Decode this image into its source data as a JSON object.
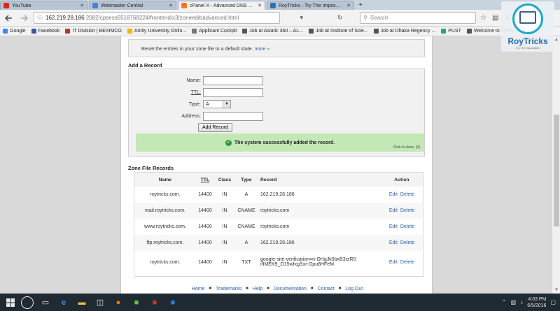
{
  "browser": {
    "tabs": [
      {
        "label": "YouTube",
        "color": "#e62117",
        "active": false
      },
      {
        "label": "Webmaster Central",
        "color": "#4a7fd6",
        "active": false
      },
      {
        "label": "cPanel X - Advanced DNS ...",
        "color": "#f47a20",
        "active": true
      },
      {
        "label": "RoyTricks - Try The Impos...",
        "color": "#2f71b5",
        "active": false
      }
    ],
    "tab_close": "✕",
    "new_tab": "+",
    "url_host": "162.219.28.186",
    "url_path": ":2082/cpsess6518768224/frontend/x3/zoneedit/advanced.html",
    "search_placeholder": "Search",
    "bookmarks": [
      {
        "label": "Google",
        "color": "#4285f4"
      },
      {
        "label": "Facebook",
        "color": "#3b5998"
      },
      {
        "label": "IT Division | BEXIMCO",
        "color": "#b33"
      },
      {
        "label": "Amity University Onlin...",
        "color": "#f4b400"
      },
      {
        "label": "Applicant Cockpit",
        "color": "#777"
      },
      {
        "label": "Job at Asiatic 360 – AL...",
        "color": "#555"
      },
      {
        "label": "Job at Institute of Scie...",
        "color": "#555"
      },
      {
        "label": "Job at Dhaka Regency ...",
        "color": "#555"
      },
      {
        "label": "PUST",
        "color": "#2a7"
      },
      {
        "label": "Welcome to DPDC C...",
        "color": "#555"
      }
    ]
  },
  "reset": {
    "text": "Reset the entries in your zone file to a default state.",
    "more": "more »"
  },
  "add_record": {
    "title": "Add a Record",
    "name_label": "Name:",
    "ttl_label": "TTL:",
    "type_label": "Type:",
    "type_value": "A",
    "address_label": "Address:",
    "button": "Add Record",
    "success": "The system successfully added the record.",
    "close_hint": "Click to close. [X]"
  },
  "zone": {
    "title": "Zone File Records",
    "headers": {
      "name": "Name",
      "ttl": "TTL",
      "class": "Class",
      "type": "Type",
      "record": "Record",
      "action": "Action"
    },
    "edit": "Edit",
    "delete": "Delete",
    "rows": [
      {
        "name": "roytricks.com.",
        "ttl": "14400",
        "class": "IN",
        "type": "A",
        "record": "162.219.28.186",
        "record2": ""
      },
      {
        "name": "mail.roytricks.com.",
        "ttl": "14400",
        "class": "IN",
        "type": "CNAME",
        "record": "roytricks.com",
        "record2": ""
      },
      {
        "name": "www.roytricks.com.",
        "ttl": "14400",
        "class": "IN",
        "type": "CNAME",
        "record": "roytricks.com",
        "record2": ""
      },
      {
        "name": "ftp.roytricks.com.",
        "ttl": "14400",
        "class": "IN",
        "type": "A",
        "record": "162.219.28.186",
        "record2": ""
      },
      {
        "name": "roytricks.com.",
        "ttl": "14400",
        "class": "IN",
        "type": "TXT",
        "record": "google-site-verification=n-OHgJk5bxB3rzR0",
        "record2": "ifIMEK9_O15wfxgSxr-Opu8HFeM"
      }
    ]
  },
  "footer": [
    "Home",
    "Trademarks",
    "Help",
    "Documentation",
    "Contact",
    "Log Out"
  ],
  "logo": {
    "brand": "RoyTricks",
    "sub": "Try The Impossible"
  },
  "taskbar": {
    "time": "4:03 PM",
    "date": "6/5/2016"
  }
}
